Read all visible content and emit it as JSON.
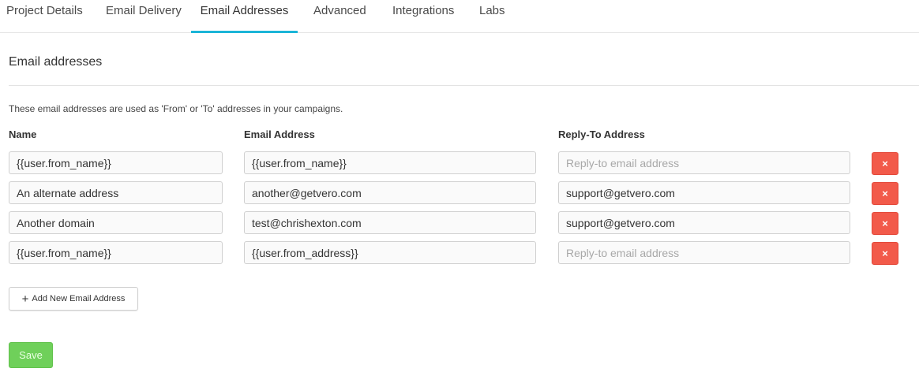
{
  "tabs": [
    {
      "label": "Project Details"
    },
    {
      "label": "Email Delivery"
    },
    {
      "label": "Email Addresses",
      "active": true
    },
    {
      "label": "Advanced"
    },
    {
      "label": "Integrations"
    },
    {
      "label": "Labs"
    }
  ],
  "section": {
    "title": "Email addresses",
    "description": "These email addresses are used as 'From' or 'To' addresses in your campaigns."
  },
  "columns": {
    "name": "Name",
    "email": "Email Address",
    "reply_to": "Reply-To Address"
  },
  "rows": [
    {
      "name": "{{user.from_name}}",
      "email": "{{user.from_name}}",
      "reply_to": ""
    },
    {
      "name": "An alternate address",
      "email": "another@getvero.com",
      "reply_to": "support@getvero.com"
    },
    {
      "name": "Another domain",
      "email": "test@chrishexton.com",
      "reply_to": "support@getvero.com"
    },
    {
      "name": "{{user.from_name}}",
      "email": "{{user.from_address}}",
      "reply_to": ""
    }
  ],
  "reply_to_placeholder": "Reply-to email address",
  "delete_glyph": "×",
  "add_button": {
    "icon": "plus-icon",
    "glyph": "+",
    "label": "Add New Email Address"
  },
  "save_label": "Save",
  "colors": {
    "accent": "#1bb5d8",
    "danger": "#f25a4a",
    "success": "#6fd05a"
  }
}
